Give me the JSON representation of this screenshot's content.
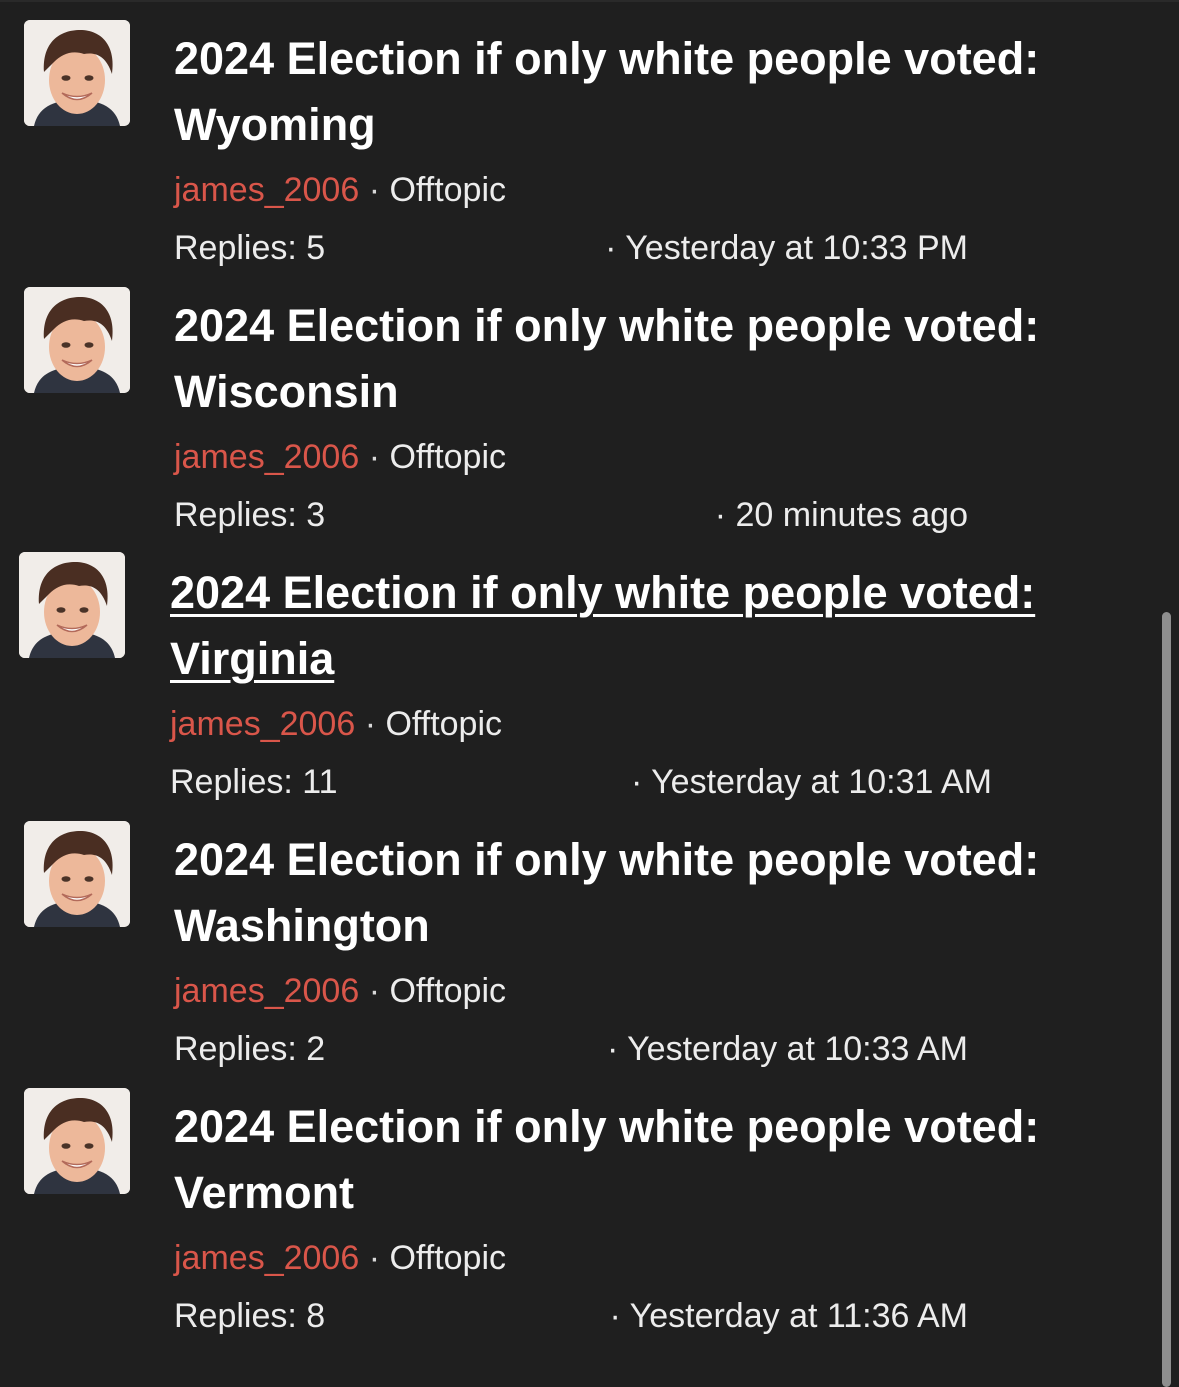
{
  "threads": [
    {
      "title": "2024 Election if only white people voted: Wyoming",
      "author": "james_2006",
      "separator": " · ",
      "forum": "Offtopic",
      "replies": "Replies: 5",
      "time": "· Yesterday at 10:33 PM",
      "avatar_icon": "user-avatar-photo"
    },
    {
      "title": "2024 Election if only white people voted: Wisconsin",
      "author": "james_2006",
      "separator": " · ",
      "forum": "Offtopic",
      "replies": "Replies: 3",
      "time": "· 20 minutes ago",
      "avatar_icon": "user-avatar-photo"
    },
    {
      "title": "2024 Election if only white people voted: Virginia",
      "author": "james_2006",
      "separator": " · ",
      "forum": "Offtopic",
      "replies": "Replies: 11",
      "time": "· Yesterday at 10:31 AM",
      "avatar_icon": "user-avatar-photo"
    },
    {
      "title": "2024 Election if only white people voted: Washington",
      "author": "james_2006",
      "separator": " · ",
      "forum": "Offtopic",
      "replies": "Replies: 2",
      "time": "· Yesterday at 10:33 AM",
      "avatar_icon": "user-avatar-photo"
    },
    {
      "title": "2024 Election if only white people voted: Vermont",
      "author": "james_2006",
      "separator": " · ",
      "forum": "Offtopic",
      "replies": "Replies: 8",
      "time": "· Yesterday at 11:36 AM",
      "avatar_icon": "user-avatar-photo"
    }
  ],
  "colors": {
    "background": "#1f1f1f",
    "author": "#d9564a",
    "text": "#ffffff",
    "muted_text": "#ececec",
    "scrollbar": "#8e8e8e"
  }
}
